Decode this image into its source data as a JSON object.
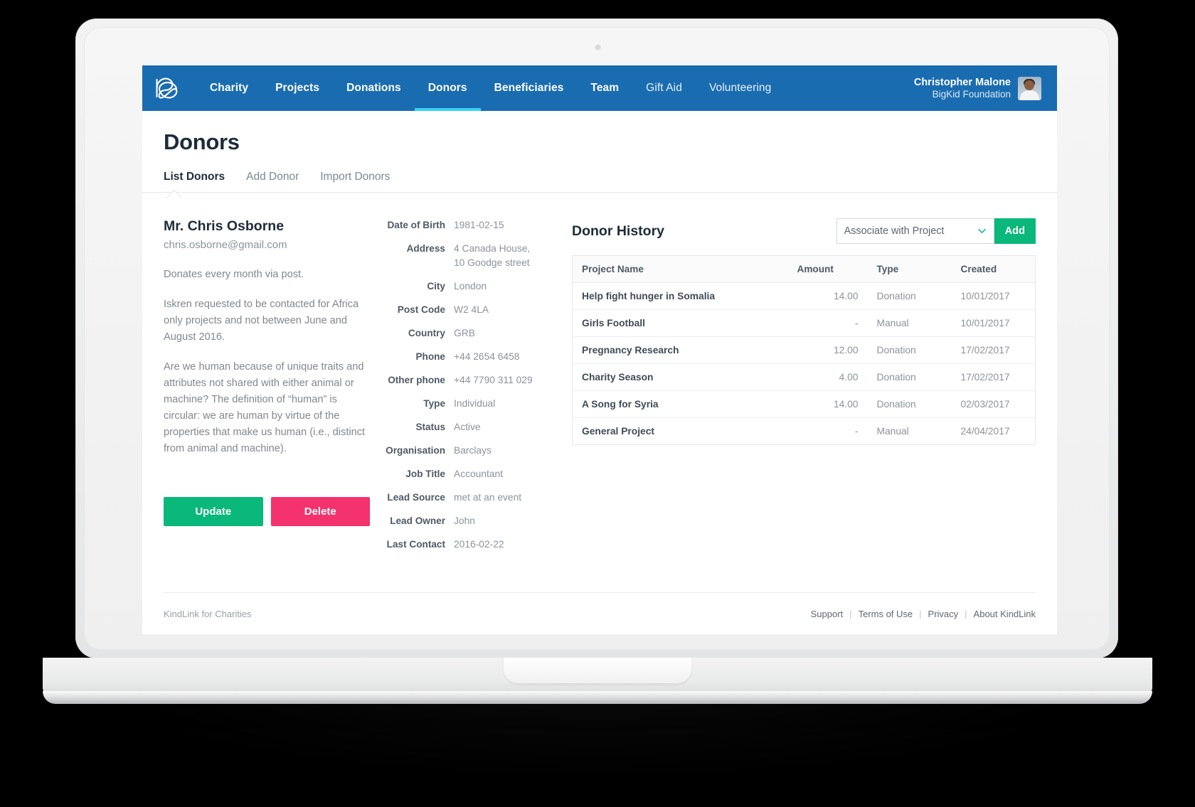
{
  "app": {
    "logo_icon": "kindlink-knot-logo",
    "nav": [
      {
        "label": "Charity",
        "active": false
      },
      {
        "label": "Projects",
        "active": false
      },
      {
        "label": "Donations",
        "active": false
      },
      {
        "label": "Donors",
        "active": true
      },
      {
        "label": "Beneficiaries",
        "active": false
      },
      {
        "label": "Team",
        "active": false
      },
      {
        "label": "Gift Aid",
        "active": false
      },
      {
        "label": "Volunteering",
        "active": false
      }
    ],
    "user": {
      "name": "Christopher Malone",
      "organisation": "BigKid Foundation",
      "avatar_icon": "user-photo-avatar"
    },
    "colors": {
      "nav_background": "#1a6cb0",
      "nav_active_underline": "#37d2f5",
      "primary_green": "#09b87a",
      "danger_pink": "#f4326d",
      "heading": "#1d2b3a"
    }
  },
  "page": {
    "title": "Donors",
    "subtabs": [
      {
        "label": "List Donors",
        "active": true
      },
      {
        "label": "Add Donor",
        "active": false
      },
      {
        "label": "Import Donors",
        "active": false
      }
    ]
  },
  "donor": {
    "name": "Mr. Chris Osborne",
    "email": "chris.osborne@gmail.com",
    "notes": [
      "Donates every month via post.",
      "Iskren requested to be contacted for Africa only projects and not between June and August 2016.",
      "Are we human because of unique traits and attributes not shared with either animal or machine? The definition of “human” is circular: we are human by virtue of the properties that make us human (i.e., distinct from animal and machine)."
    ],
    "fields": [
      {
        "label": "Date of Birth",
        "value": "1981-02-15"
      },
      {
        "label": "Address",
        "value": "4 Canada House, 10 Goodge street"
      },
      {
        "label": "City",
        "value": "London"
      },
      {
        "label": "Post Code",
        "value": "W2 4LA"
      },
      {
        "label": "Country",
        "value": "GRB"
      },
      {
        "label": "Phone",
        "value": "+44 2654 6458"
      },
      {
        "label": "Other phone",
        "value": "+44 7790 311 029"
      },
      {
        "label": "Type",
        "value": "Individual"
      },
      {
        "label": "Status",
        "value": "Active"
      },
      {
        "label": "Organisation",
        "value": "Barclays"
      },
      {
        "label": "Job Title",
        "value": "Accountant"
      },
      {
        "label": "Lead Source",
        "value": "met at an event"
      },
      {
        "label": "Lead Owner",
        "value": "John"
      },
      {
        "label": "Last Contact",
        "value": "2016-02-22"
      }
    ],
    "actions": {
      "update_label": "Update",
      "delete_label": "Delete"
    }
  },
  "history": {
    "title": "Donor History",
    "project_select": {
      "selected": "Associate with Project",
      "chevron_icon": "chevron-down-icon"
    },
    "add_label": "Add",
    "columns": [
      "Project Name",
      "Amount",
      "Type",
      "Created"
    ],
    "rows": [
      {
        "project": "Help fight hunger in Somalia",
        "amount": "14.00",
        "type": "Donation",
        "created": "10/01/2017"
      },
      {
        "project": "Girls Football",
        "amount": "-",
        "type": "Manual",
        "created": "10/01/2017"
      },
      {
        "project": "Pregnancy Research",
        "amount": "12.00",
        "type": "Donation",
        "created": "17/02/2017"
      },
      {
        "project": "Charity Season",
        "amount": "4.00",
        "type": "Donation",
        "created": "17/02/2017"
      },
      {
        "project": "A Song for Syria",
        "amount": "14.00",
        "type": "Donation",
        "created": "02/03/2017"
      },
      {
        "project": "General Project",
        "amount": "-",
        "type": "Manual",
        "created": "24/04/2017"
      }
    ]
  },
  "footer": {
    "copy": "KindLink for Charities",
    "links": [
      "Support",
      "Terms of Use",
      "Privacy",
      "About KindLink"
    ],
    "separator": "|"
  }
}
